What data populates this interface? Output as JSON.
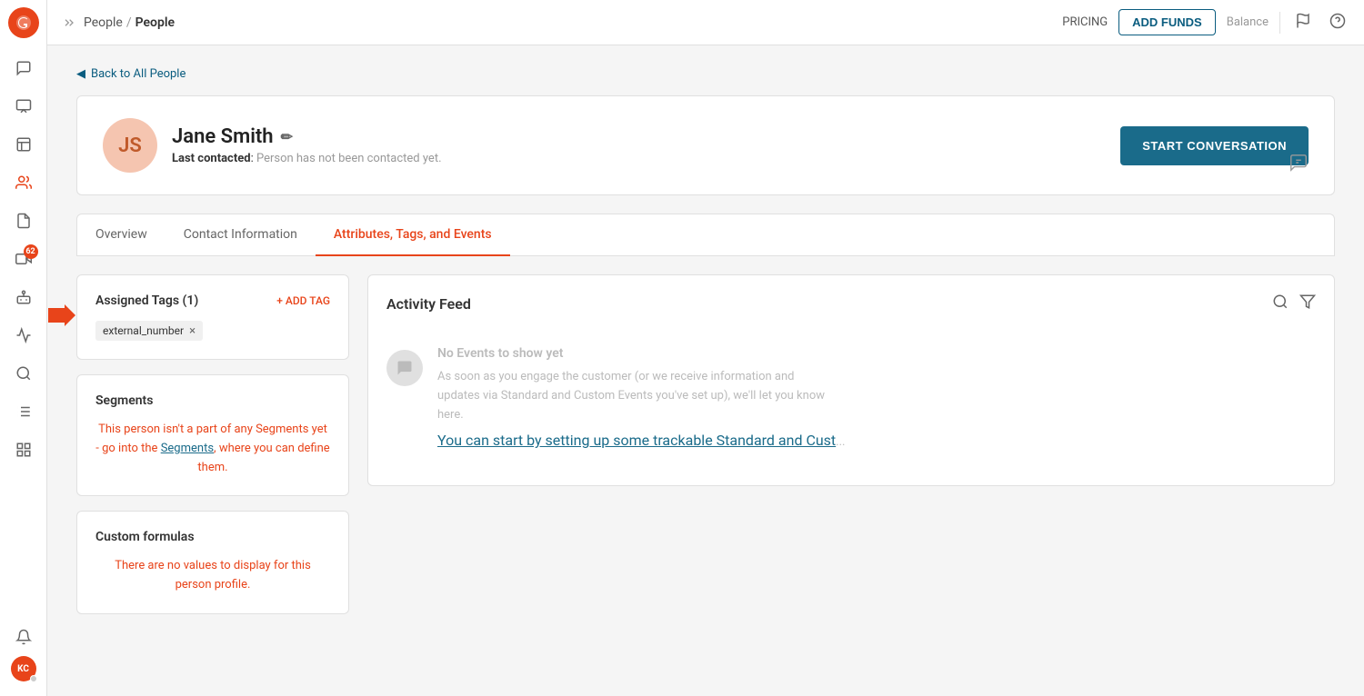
{
  "topbar": {
    "breadcrumb_parent": "People",
    "breadcrumb_sep": "/",
    "breadcrumb_current": "People",
    "pricing_label": "PRICING",
    "add_funds_label": "ADD FUNDS",
    "balance_label": "Balance"
  },
  "sidebar": {
    "logo_alt": "app-logo",
    "nav_items": [
      {
        "name": "conversations",
        "icon": "chat-bubbles"
      },
      {
        "name": "inbox",
        "icon": "inbox"
      },
      {
        "name": "contacts",
        "icon": "contacts",
        "active": true
      },
      {
        "name": "segments",
        "icon": "segments"
      },
      {
        "name": "campaigns",
        "icon": "campaigns",
        "badge": "62"
      },
      {
        "name": "bots",
        "icon": "bots"
      },
      {
        "name": "reports",
        "icon": "reports"
      },
      {
        "name": "settings",
        "icon": "settings"
      },
      {
        "name": "audit",
        "icon": "audit"
      },
      {
        "name": "apps",
        "icon": "apps"
      }
    ],
    "bottom": {
      "bell_icon": "bell",
      "avatar_initials": "KC",
      "avatar_status": "offline"
    }
  },
  "back_link": "Back to All People",
  "profile": {
    "initials": "JS",
    "name": "Jane Smith",
    "last_contacted_label": "Last contacted",
    "last_contacted_value": "Person has not been contacted yet.",
    "start_conversation_label": "START CONVERSATION"
  },
  "tabs": [
    {
      "label": "Overview",
      "active": false
    },
    {
      "label": "Contact Information",
      "active": false
    },
    {
      "label": "Attributes, Tags, and Events",
      "active": true
    }
  ],
  "tags_panel": {
    "title": "Assigned Tags (1)",
    "add_tag_label": "+ ADD TAG",
    "tags": [
      {
        "name": "external_number"
      }
    ]
  },
  "segments_panel": {
    "title": "Segments",
    "text_before": "This person isn't a part of any Segments yet - go into the ",
    "link_text": "Segments",
    "text_after": ", where you can define them."
  },
  "custom_formulas_panel": {
    "title": "Custom formulas",
    "text": "There are no values to display for this person profile."
  },
  "activity_feed": {
    "title": "Activity Feed",
    "no_events_title": "No Events to show yet",
    "no_events_desc": "As soon as you engage the customer (or we receive information and updates via Standard and Custom Events you've set up), we'll let you know here.",
    "no_events_link": "You can start by setting up some trackable Standard and Cust",
    "no_events_link_suffix": "..."
  }
}
